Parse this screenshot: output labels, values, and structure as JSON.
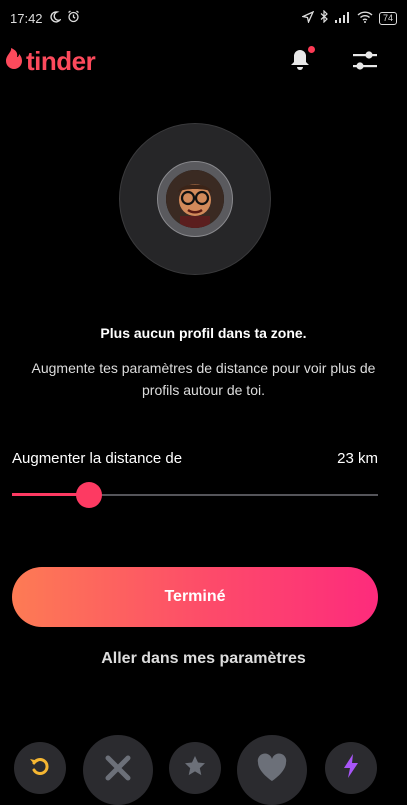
{
  "status_bar": {
    "time": "17:42",
    "battery": "74"
  },
  "header": {
    "logo_text": "tinder",
    "icons": [
      "flame-icon",
      "bell-icon",
      "settings-sliders-icon"
    ],
    "notification_dot_color": "#fd3a55"
  },
  "empty_state": {
    "title": "Plus aucun profil dans ta zone.",
    "description": "Augmente tes paramètres de distance pour voir plus de profils autour de toi."
  },
  "distance": {
    "label": "Augmenter la distance de",
    "value": "23 km",
    "slider_fraction": 0.21
  },
  "primary_button": {
    "label": "Terminé"
  },
  "secondary_link": {
    "label": "Aller dans mes paramètres"
  },
  "action_bar": {
    "buttons": [
      "rewind-icon",
      "nope-x-icon",
      "super-like-star-icon",
      "like-heart-icon",
      "boost-bolt-icon"
    ]
  },
  "colors": {
    "brand": "#fd4a5c",
    "accent": "#fd3a62",
    "rewind": "#f5b632",
    "boost": "#a855f7",
    "background": "#000000"
  }
}
